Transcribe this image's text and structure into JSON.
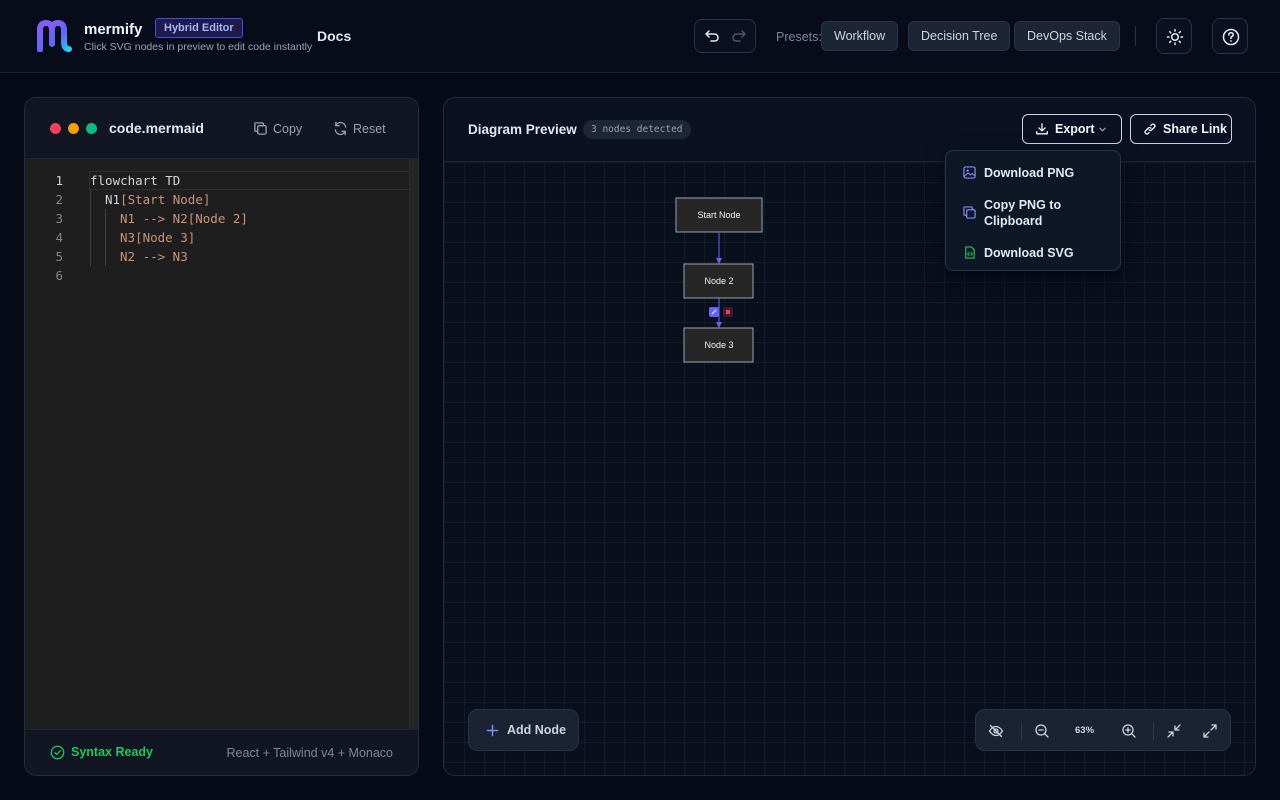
{
  "header": {
    "brand": "mermify",
    "badge": "Hybrid Editor",
    "tagline": "Click SVG nodes in preview to edit code instantly",
    "docs": "Docs",
    "presets_label": "Presets:",
    "presets": [
      "Workflow",
      "Decision Tree",
      "DevOps Stack"
    ]
  },
  "editor": {
    "file_name": "code.mermaid",
    "copy_label": "Copy",
    "reset_label": "Reset",
    "lines": [
      {
        "n": "1",
        "pre": "flowchart TD",
        "str": ""
      },
      {
        "n": "2",
        "pre": "N1",
        "str": "[Start Node]"
      },
      {
        "n": "3",
        "pre": "N1 --> N2",
        "str": "[Node 2]"
      },
      {
        "n": "4",
        "pre": "N3",
        "str": "[Node 3]"
      },
      {
        "n": "5",
        "pre": "N2 --> N3",
        "str": ""
      },
      {
        "n": "6",
        "pre": "",
        "str": ""
      }
    ],
    "status": "Syntax Ready",
    "tech_stack": "React + Tailwind v4 + Monaco"
  },
  "preview": {
    "title": "Diagram Preview",
    "nodes_badge": "3 nodes detected",
    "export_label": "Export",
    "share_label": "Share Link",
    "export_menu": {
      "download_png": "Download PNG",
      "copy_png_line1": "Copy PNG to",
      "copy_png_line2": "Clipboard",
      "download_svg": "Download SVG"
    },
    "diagram": {
      "nodes": [
        "Start Node",
        "Node 2",
        "Node 3"
      ]
    },
    "add_node_label": "Add Node",
    "zoom_level": "63%"
  },
  "colors": {
    "accent": "#6366f1",
    "success": "#22c55e",
    "code_string": "#ce9178"
  }
}
